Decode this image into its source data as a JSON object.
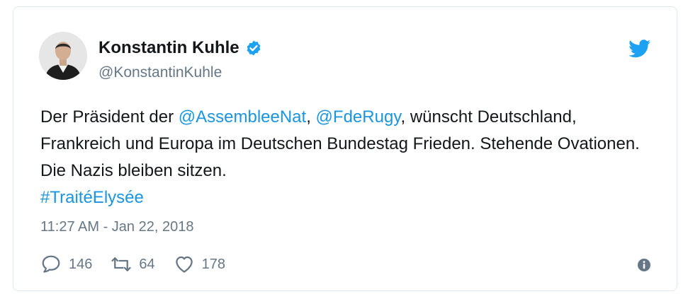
{
  "author": {
    "name": "Konstantin Kuhle",
    "handle": "@KonstantinKuhle",
    "verified": true
  },
  "tweet": {
    "text_prefix": "Der Präsident der ",
    "mention_1": "@AssembleeNat",
    "sep_1": ", ",
    "mention_2": "@FdeRugy",
    "text_body": ", wünscht Deutschland, Frankreich und Europa im Deutschen Bundestag Frieden. Stehende Ovationen. Die Nazis bleiben sitzen.",
    "hashtag": "#TraitéElysée"
  },
  "timestamp": "11:27 AM - Jan 22, 2018",
  "stats": {
    "replies": "146",
    "retweets": "64",
    "likes": "178"
  },
  "colors": {
    "link": "#1b95e0",
    "secondary_text": "#657786",
    "primary_text": "#14171a"
  },
  "icons": {
    "brand": "twitter-bird-icon",
    "verified": "verified-badge-icon",
    "reply": "reply-icon",
    "retweet": "retweet-icon",
    "like": "heart-icon",
    "info": "info-icon"
  }
}
